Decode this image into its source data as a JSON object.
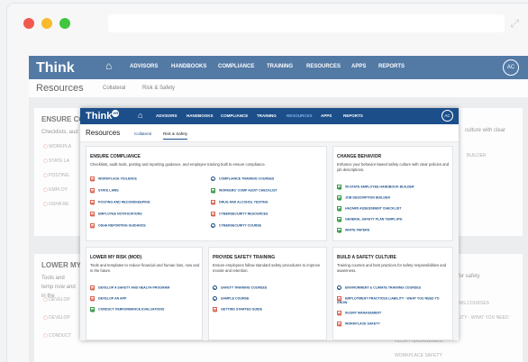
{
  "front": {
    "nav": {
      "logo": "Think",
      "logo_badge": "HR",
      "items": [
        "ADVISORS",
        "HANDBOOKS",
        "COMPLIANCE",
        "TRAINING",
        "RESOURCES",
        "APPS",
        "REPORTS"
      ],
      "active": "RESOURCES",
      "avatar": "AC"
    },
    "sub": {
      "title": "Resources",
      "tabs": [
        "Collateral",
        "Risk & Safety"
      ],
      "active_tab": "Risk & Safety"
    },
    "cards": {
      "compliance": {
        "title": "ENSURE COMPLIANCE",
        "desc": "Checklists, audit tools, posting and reporting guidance, and employee training built to ensure compliance.",
        "col1": [
          {
            "icon": "pdf",
            "label": "WORKPLACE VIOLENCE"
          },
          {
            "icon": "pdf",
            "label": "STATE LAWS"
          },
          {
            "icon": "pdf",
            "label": "POSTING AND RECORDKEEPING"
          },
          {
            "icon": "pdf",
            "label": "EMPLOYEE NOTIFICATIONS"
          },
          {
            "icon": "pdf",
            "label": "OSHA REPORTING GUIDANCE"
          }
        ],
        "col2": [
          {
            "icon": "play",
            "label": "COMPLIANCE TRAINING COURSES"
          },
          {
            "icon": "doc",
            "label": "WORKERS' COMP AUDIT CHECKLIST"
          },
          {
            "icon": "pdf",
            "label": "DRUG AND ALCOHOL TESTING"
          },
          {
            "icon": "pdf",
            "label": "CYBERSECURITY RESOURCES"
          },
          {
            "icon": "play",
            "label": "CYBERSECURITY COURSE"
          }
        ]
      },
      "behavior": {
        "title": "CHANGE BEHAVIOR",
        "desc": "Enhance your behavior-based safety culture with clear policies and job descriptions.",
        "items": [
          {
            "icon": "doc",
            "label": "50-STATE EMPLOYEE HANDBOOK BUILDER"
          },
          {
            "icon": "doc",
            "label": "JOB DESCRIPTION BUILDER"
          },
          {
            "icon": "doc",
            "label": "HAZARD ASSESSMENT CHECKLIST"
          },
          {
            "icon": "doc",
            "label": "GENERAL SAFETY PLAN TEMPLATE"
          },
          {
            "icon": "doc",
            "label": "WHITE PAPERS"
          }
        ]
      },
      "risk": {
        "title": "LOWER MY RISK (MOD)",
        "desc": "Tools and templates to reduce financial and human loss, now and in the future.",
        "items": [
          {
            "icon": "pdf",
            "label": "DEVELOP A SAFETY AND HEALTH PROGRAM"
          },
          {
            "icon": "pdf",
            "label": "DEVELOP AN APP"
          },
          {
            "icon": "doc",
            "label": "CONDUCT PERFORMANCE EVALUATIONS"
          }
        ]
      },
      "training": {
        "title": "PROVIDE SAFETY TRAINING",
        "desc": "Ensure employees follow standard safety procedures to improve morale and retention.",
        "items": [
          {
            "icon": "play",
            "label": "SAFETY TRAINING COURSES"
          },
          {
            "icon": "play",
            "label": "SAMPLE COURSE"
          },
          {
            "icon": "pdf",
            "label": "GETTING STARTED GUIDE"
          }
        ]
      },
      "culture": {
        "title": "BUILD A SAFETY CULTURE",
        "desc": "Training courses and best practices for safety responsibilities and awareness.",
        "items": [
          {
            "icon": "play",
            "label": "ENVIRONMENT & CLIMATE TRAINING COURSES"
          },
          {
            "icon": "pdf",
            "label": "EMPLOYMENT PRACTICES LIABILITY - WHAT YOU NEED TO KNOW"
          },
          {
            "icon": "pdf",
            "label": "INJURY MANAGEMENT"
          },
          {
            "icon": "pdf",
            "label": "WORKPLACE SAFETY"
          }
        ]
      }
    }
  },
  "back": {
    "nav": {
      "logo": "Think",
      "items": [
        "ADVISORS",
        "HANDBOOKS",
        "COMPLIANCE",
        "TRAINING",
        "RESOURCES",
        "APPS",
        "REPORTS"
      ],
      "avatar": "AC"
    },
    "sub": {
      "title": "Resources",
      "tabs": [
        "Collateral",
        "Risk & Safety"
      ]
    },
    "card1": {
      "title": "ENSURE CON",
      "desc": "Checklists, aud",
      "items": [
        "WORKPLA",
        "STATE LA",
        "POSTING",
        "EMPLOY",
        "OSHA RE"
      ],
      "right_text": "culture with clear",
      "right_items": [
        "BUILDER"
      ]
    },
    "card2": {
      "title": "LOWER MY R",
      "desc": "Tools and temp now and in the",
      "items": [
        "DEVELOP",
        "DEVELOP",
        "CONDUCT"
      ],
      "right_text": "for safety",
      "right_items": [
        "ING COURSES",
        "LITY - WHAT YOU NEED",
        "INJURY MANAGEMENT",
        "WORKPLACE SAFETY"
      ]
    }
  }
}
